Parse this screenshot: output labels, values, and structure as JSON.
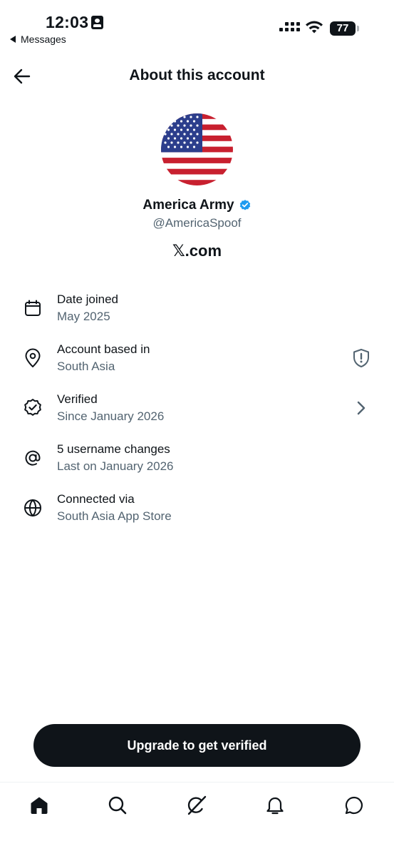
{
  "status_bar": {
    "time": "12:03",
    "back_app_label": "Messages",
    "battery": "77"
  },
  "header": {
    "title": "About this account"
  },
  "profile": {
    "display_name": "America Army",
    "handle": "@AmericaSpoof",
    "site": "𝕏.com",
    "verified_color": "#1d9bf0"
  },
  "info": [
    {
      "icon": "calendar-icon",
      "label": "Date joined",
      "value": "May 2025"
    },
    {
      "icon": "location-pin-icon",
      "label": "Account based in",
      "value": "South Asia",
      "trail": "shield-alert-icon"
    },
    {
      "icon": "verified-badge-icon",
      "label": "Verified",
      "value": "Since January 2026",
      "trail": "chevron-right-icon"
    },
    {
      "icon": "at-sign-icon",
      "label": "5 username changes",
      "value": "Last on January 2026"
    },
    {
      "icon": "globe-icon",
      "label": "Connected via",
      "value": "South Asia App Store"
    }
  ],
  "cta": {
    "label": "Upgrade to get verified"
  },
  "nav": [
    "home-icon",
    "search-icon",
    "grok-icon",
    "notifications-icon",
    "messages-icon"
  ]
}
